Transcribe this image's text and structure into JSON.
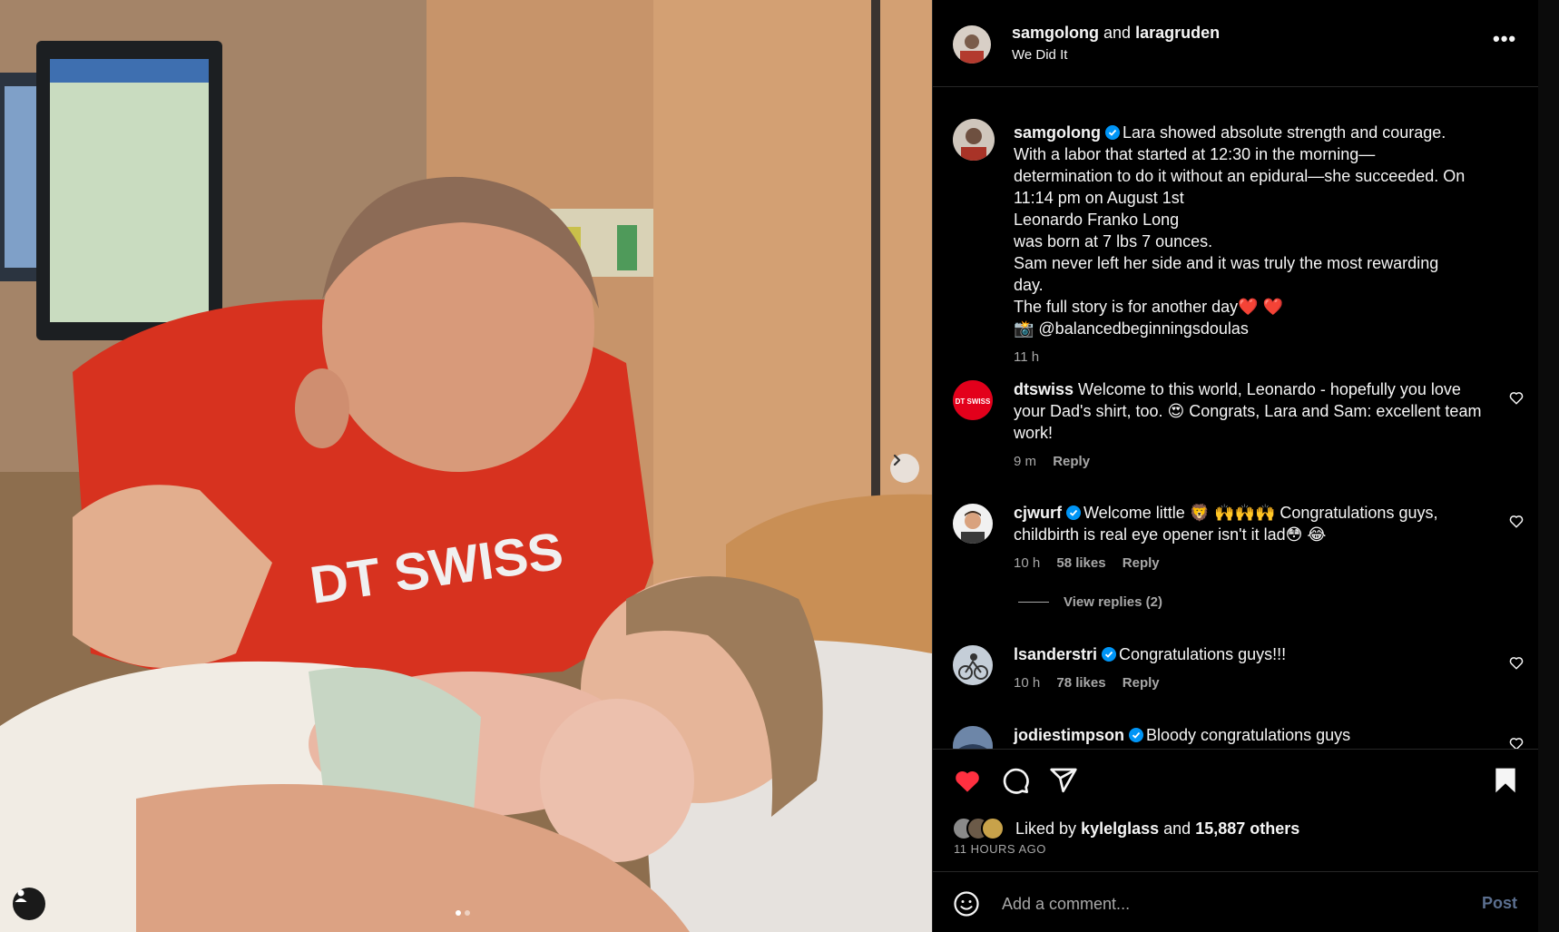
{
  "header": {
    "user1": "samgolong",
    "joiner": "and",
    "user2": "laragruden",
    "subtitle": "We Did It",
    "more": "•••"
  },
  "caption": {
    "username": "samgolong",
    "lines": [
      "Lara showed absolute strength and courage.",
      "With a labor that started at 12:30 in the morning—",
      "determination to do it without an epidural—she succeeded. On",
      "11:14 pm on August 1st",
      "Leonardo Franko Long",
      "was born at 7 lbs 7 ounces.",
      "Sam never left her side and it was truly the most rewarding",
      "day.",
      "The full story is for another day❤️ ❤️",
      "📸 @balancedbeginningsdoulas"
    ],
    "time": "11 h"
  },
  "comments": [
    {
      "username": "dtswiss",
      "verified": false,
      "text": "Welcome to this world, Leonardo - hopefully you love your Dad's shirt, too. 😍 Congrats, Lara and Sam: excellent team work!",
      "time": "9 m",
      "likes": "",
      "reply": "Reply"
    },
    {
      "username": "cjwurf",
      "verified": true,
      "text": "Welcome little 🦁 🙌🙌🙌 Congratulations guys, childbirth is real eye opener isn't it lad😳 😂",
      "time": "10 h",
      "likes": "58 likes",
      "reply": "Reply"
    },
    {
      "username": "lsanderstri",
      "verified": true,
      "text": "Congratulations guys!!!",
      "time": "10 h",
      "likes": "78 likes",
      "reply": "Reply"
    },
    {
      "username": "jodiestimpson",
      "verified": true,
      "text": "Bloody congratulations guys",
      "time": "",
      "likes": "",
      "reply": ""
    }
  ],
  "view_replies": "View replies (2)",
  "dtswiss_logo": "DT SWISS",
  "likes": {
    "prefix": "Liked by",
    "user": "kylelglass",
    "joiner": "and",
    "others": "15,887 others"
  },
  "posted": "11 HOURS AGO",
  "add_comment": {
    "placeholder": "Add a comment...",
    "post": "Post"
  },
  "colors": {
    "like": "#ff3040",
    "verified": "#0095f6",
    "post_disabled": "#5b6f8f"
  },
  "icons": [
    "heart-icon",
    "comment-icon",
    "share-icon",
    "bookmark-icon",
    "emoji-icon",
    "chevron-right-icon",
    "user-tag-icon",
    "more-icon"
  ]
}
